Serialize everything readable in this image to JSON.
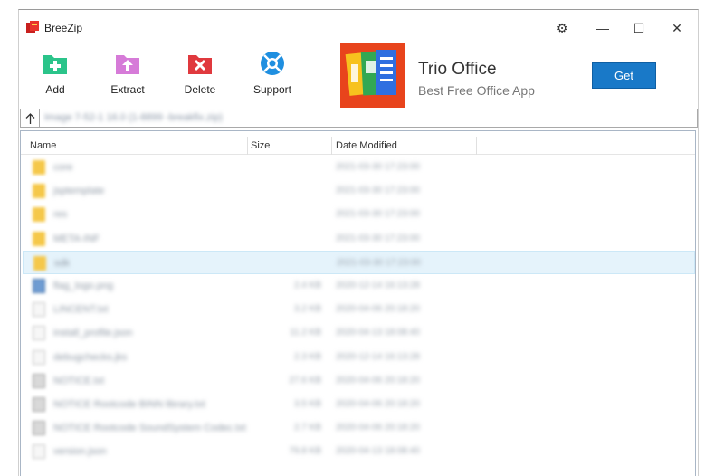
{
  "window": {
    "title": "BreeZip",
    "controls": {
      "settings": "⚙",
      "minimize": "—",
      "maximize": "☐",
      "close": "✕"
    }
  },
  "toolbar": {
    "add_label": "Add",
    "extract_label": "Extract",
    "delete_label": "Delete",
    "support_label": "Support"
  },
  "ad": {
    "title": "Trio Office",
    "subtitle": "Best Free Office App",
    "button_label": "Get"
  },
  "pathbar": {
    "path": "Image 7-52-1 16.0 (1-8899 -breakfix.zip)"
  },
  "filelist": {
    "columns": {
      "name": "Name",
      "size": "Size",
      "date": "Date Modified"
    },
    "rows": [
      {
        "name": "core",
        "size": "",
        "date": "2021-03-30 17:23:00",
        "kind": "folder"
      },
      {
        "name": "jsptemplate",
        "size": "",
        "date": "2021-03-30 17:23:00",
        "kind": "folder"
      },
      {
        "name": "res",
        "size": "",
        "date": "2021-03-30 17:23:00",
        "kind": "folder"
      },
      {
        "name": "META-INF",
        "size": "",
        "date": "2021-03-30 17:23:00",
        "kind": "folder"
      },
      {
        "name": "sdk",
        "size": "",
        "date": "2021-03-30 17:23:00",
        "kind": "folder"
      },
      {
        "name": "flag_logo.png",
        "size": "2.4 KB",
        "date": "2020-12-14 16:13:28",
        "kind": "img"
      },
      {
        "name": "LINCENT.txt",
        "size": "3.2 KB",
        "date": "2020-04-06 20:18:20",
        "kind": "file"
      },
      {
        "name": "install_profile.json",
        "size": "11.2 KB",
        "date": "2020-04-13 18:08:40",
        "kind": "file"
      },
      {
        "name": "debugchecks.jks",
        "size": "2.3 KB",
        "date": "2020-12-14 16:13:28",
        "kind": "file"
      },
      {
        "name": "NOTICE.txt",
        "size": "27.6 KB",
        "date": "2020-04-06 20:18:20",
        "kind": "dark"
      },
      {
        "name": "NOTICE Rootcode BINN library.txt",
        "size": "3.5 KB",
        "date": "2020-04-06 20:18:20",
        "kind": "dark"
      },
      {
        "name": "NOTICE Rootcode SoundSystem Codec.txt",
        "size": "2.7 KB",
        "date": "2020-04-06 20:18:20",
        "kind": "dark"
      },
      {
        "name": "version.json",
        "size": "79.8 KB",
        "date": "2020-04-13 18:08:40",
        "kind": "file"
      }
    ],
    "selected_index": 4
  },
  "colors": {
    "accent": "#1979c8",
    "selection": "#e5f3fb",
    "add_icon": "#2bc48a",
    "extract_icon": "#d67bd8",
    "delete_icon": "#e0393e",
    "support_icon": "#1f8fe0"
  },
  "icons": {
    "app": "breezip-logo-icon",
    "add": "add-folder-icon",
    "extract": "extract-folder-icon",
    "delete": "delete-folder-icon",
    "support": "lifebuoy-icon",
    "up": "arrow-up-icon"
  }
}
